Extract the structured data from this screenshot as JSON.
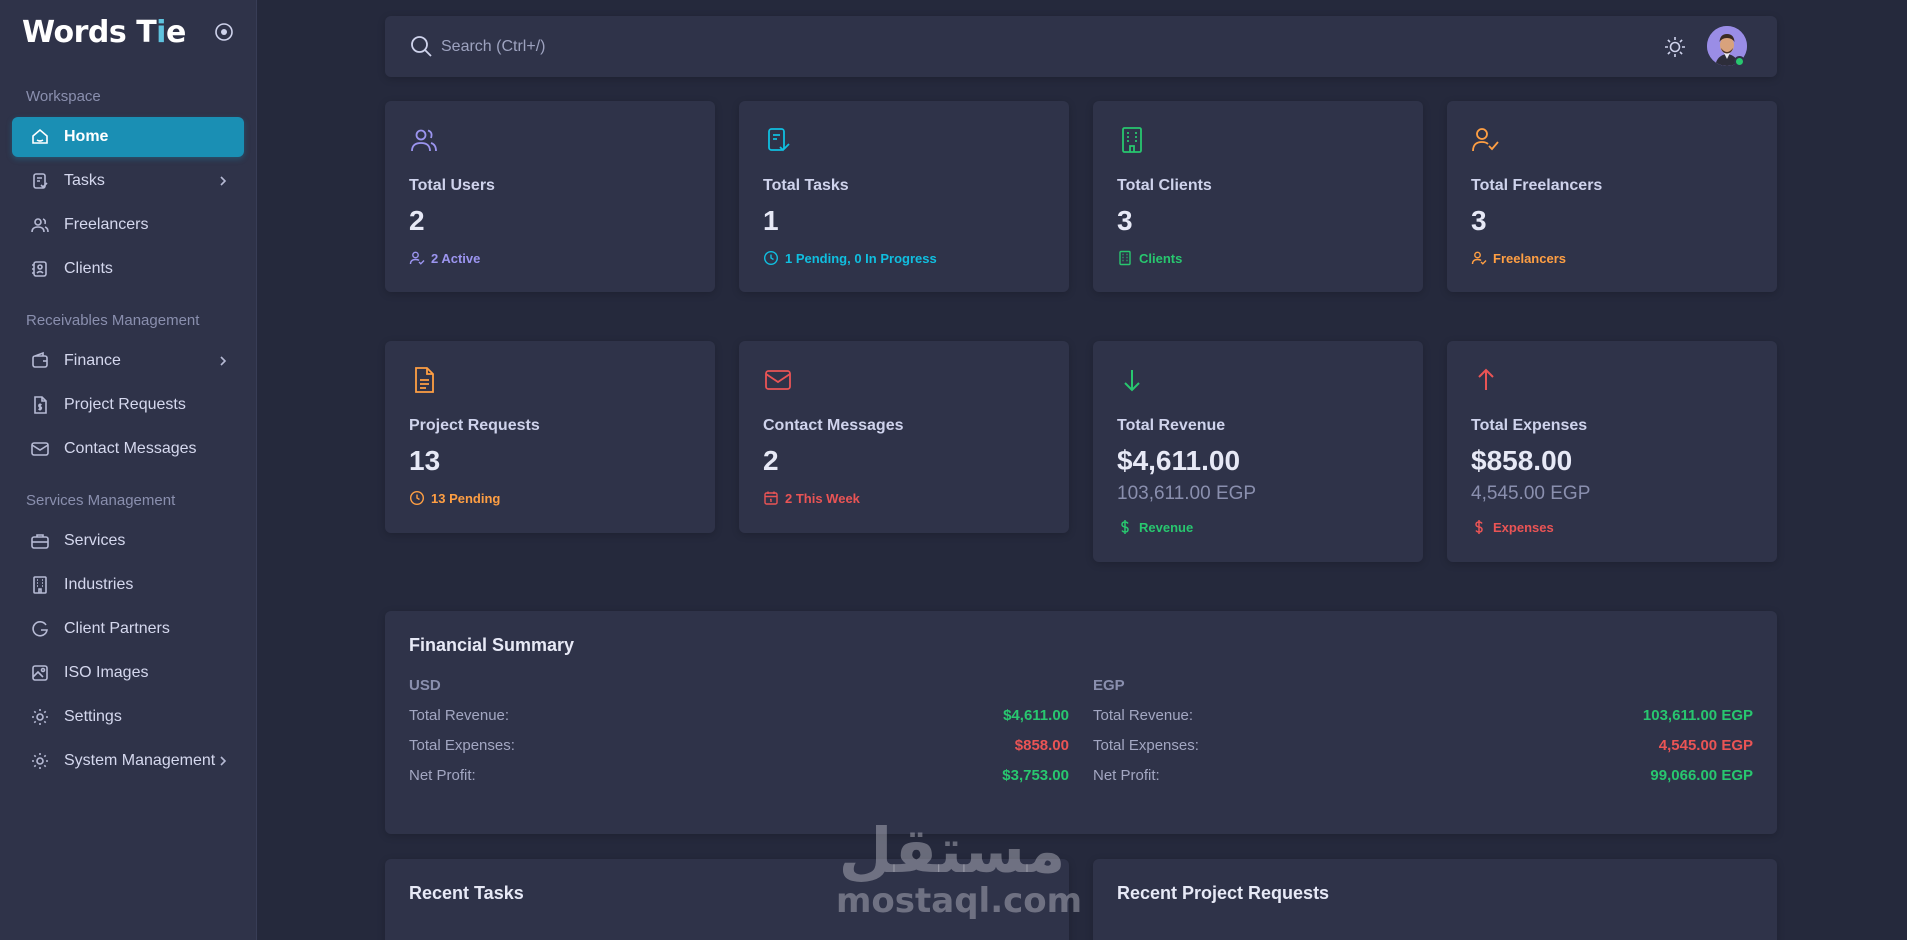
{
  "brand": {
    "name_part1": "Words T",
    "name_part2": "i",
    "name_part3": "e"
  },
  "sidebar": {
    "sections": [
      "Workspace",
      "Receivables Management",
      "Services Management"
    ],
    "items": [
      {
        "label": "Home",
        "icon": "home-icon"
      },
      {
        "label": "Tasks",
        "icon": "tasks-icon"
      },
      {
        "label": "Freelancers",
        "icon": "users-icon"
      },
      {
        "label": "Clients",
        "icon": "clients-icon"
      },
      {
        "label": "Finance",
        "icon": "wallet-icon"
      },
      {
        "label": "Project Requests",
        "icon": "file-dollar-icon"
      },
      {
        "label": "Contact Messages",
        "icon": "mail-icon"
      },
      {
        "label": "Services",
        "icon": "briefcase-icon"
      },
      {
        "label": "Industries",
        "icon": "building-icon"
      },
      {
        "label": "Client Partners",
        "icon": "partners-icon"
      },
      {
        "label": "ISO Images",
        "icon": "image-icon"
      },
      {
        "label": "Settings",
        "icon": "gear-icon"
      },
      {
        "label": "System Management",
        "icon": "gear-icon"
      }
    ]
  },
  "search": {
    "placeholder": "Search (Ctrl+/)"
  },
  "stats": [
    {
      "label": "Total Users",
      "value": "2",
      "footer": "2 Active",
      "icon": "users-icon",
      "color": "#9c95f0"
    },
    {
      "label": "Total Tasks",
      "value": "1",
      "footer": "1 Pending, 0 In Progress",
      "icon": "task-check-icon",
      "color": "#10bfe0"
    },
    {
      "label": "Total Clients",
      "value": "3",
      "footer": "Clients",
      "icon": "building-icon",
      "color": "#28c76f"
    },
    {
      "label": "Total Freelancers",
      "value": "3",
      "footer": "Freelancers",
      "icon": "user-check-icon",
      "color": "#ff9f43"
    },
    {
      "label": "Project Requests",
      "value": "13",
      "footer": "13 Pending",
      "icon": "file-icon",
      "color": "#ff9f43"
    },
    {
      "label": "Contact Messages",
      "value": "2",
      "footer": "2 This Week",
      "icon": "mail-icon",
      "color": "#ea5455"
    },
    {
      "label": "Total Revenue",
      "value": "$4,611.00",
      "secondary": "103,611.00 EGP",
      "footer": "Revenue",
      "icon": "arrow-down-icon",
      "color": "#28c76f"
    },
    {
      "label": "Total Expenses",
      "value": "$858.00",
      "secondary": "4,545.00 EGP",
      "footer": "Expenses",
      "icon": "arrow-up-icon",
      "color": "#ea5455"
    }
  ],
  "financial": {
    "title": "Financial Summary",
    "usd": {
      "heading": "USD",
      "rows": [
        {
          "label": "Total Revenue:",
          "value": "$4,611.00"
        },
        {
          "label": "Total Expenses:",
          "value": "$858.00"
        },
        {
          "label": "Net Profit:",
          "value": "$3,753.00"
        }
      ]
    },
    "egp": {
      "heading": "EGP",
      "rows": [
        {
          "label": "Total Revenue:",
          "value": "103,611.00 EGP"
        },
        {
          "label": "Total Expenses:",
          "value": "4,545.00 EGP"
        },
        {
          "label": "Net Profit:",
          "value": "99,066.00 EGP"
        }
      ]
    }
  },
  "recent": {
    "tasks_title": "Recent Tasks",
    "requests_title": "Recent Project Requests"
  },
  "watermark": {
    "arabic": "مستقل",
    "latin": "mostaql.com"
  }
}
